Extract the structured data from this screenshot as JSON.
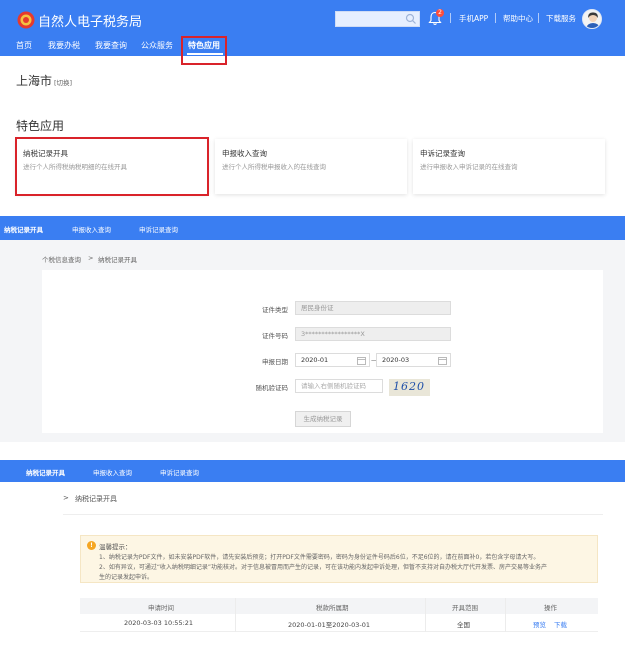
{
  "header": {
    "site_title": "自然人电子税务局",
    "search_placeholder": "",
    "bell_badge": "2",
    "links": [
      "手机APP",
      "帮助中心",
      "下载服务"
    ]
  },
  "nav": {
    "items": [
      "首页",
      "我要办税",
      "我要查询",
      "公众服务",
      "特色应用"
    ],
    "active": "特色应用"
  },
  "city": {
    "name": "上海市",
    "switch_label": "[切换]"
  },
  "special_apps": {
    "title": "特色应用",
    "cards": [
      {
        "title": "纳税记录开具",
        "desc": "进行个人所得税纳税明细的在线开具"
      },
      {
        "title": "申报收入查询",
        "desc": "进行个人所得税申报收入的在线查询"
      },
      {
        "title": "申诉记录查询",
        "desc": "进行申报收入申诉记录的在线查询"
      }
    ]
  },
  "section2": {
    "tabs": [
      "纳税记录开具",
      "申报收入查询",
      "申诉记录查询"
    ],
    "breadcrumb": {
      "root": "个税信息查询",
      "sep": ">",
      "current": "纳税记录开具"
    },
    "form": {
      "id_type_label": "证件类型",
      "id_type_value": "居民身份证",
      "id_number_label": "证件号码",
      "id_number_value": "3*****************X",
      "date_label": "申报日期",
      "date_from": "2020-01",
      "date_to": "2020-03",
      "date_dash": "—",
      "captcha_label": "随机验证码",
      "captcha_placeholder": "请输入右侧随机验证码",
      "captcha_text": "1620",
      "submit_label": "生成纳税记录"
    }
  },
  "section3": {
    "tabs": [
      "纳税记录开具",
      "申报收入查询",
      "申诉记录查询"
    ],
    "breadcrumb": {
      "sep": ">",
      "current": "纳税记录开具"
    },
    "notice": {
      "icon": "!",
      "title": "温馨提示：",
      "lines": [
        "1、纳税记录为PDF文件，如未安装PDF软件，请先安装后预览；打开PDF文件需要密码，密码为身份证件号码后6位，不足6位的，请在前面补0，若包含字母请大写。",
        "2、如有异议，可通过“收入纳税明细记录”功能核对。对于信息被冒用而产生的记录，可在该功能内发起申诉处理，但暂不支持对自办税大厅代开发票、房产交易等业务产",
        "生的记录发起申诉。"
      ]
    },
    "table": {
      "headers": [
        "申请时间",
        "税款所属期",
        "开具范围",
        "操作"
      ],
      "rows": [
        {
          "time": "2020-03-03 10:55:21",
          "period": "2020-01-01至2020-03-01",
          "scope": "全国",
          "actions": [
            "预览",
            "下载"
          ]
        }
      ]
    }
  },
  "colors": {
    "brand_blue": "#3a7ef2",
    "highlight_red": "#d9232a",
    "notice_bg": "#fdf6e4",
    "link_blue": "#3a7ef2"
  }
}
